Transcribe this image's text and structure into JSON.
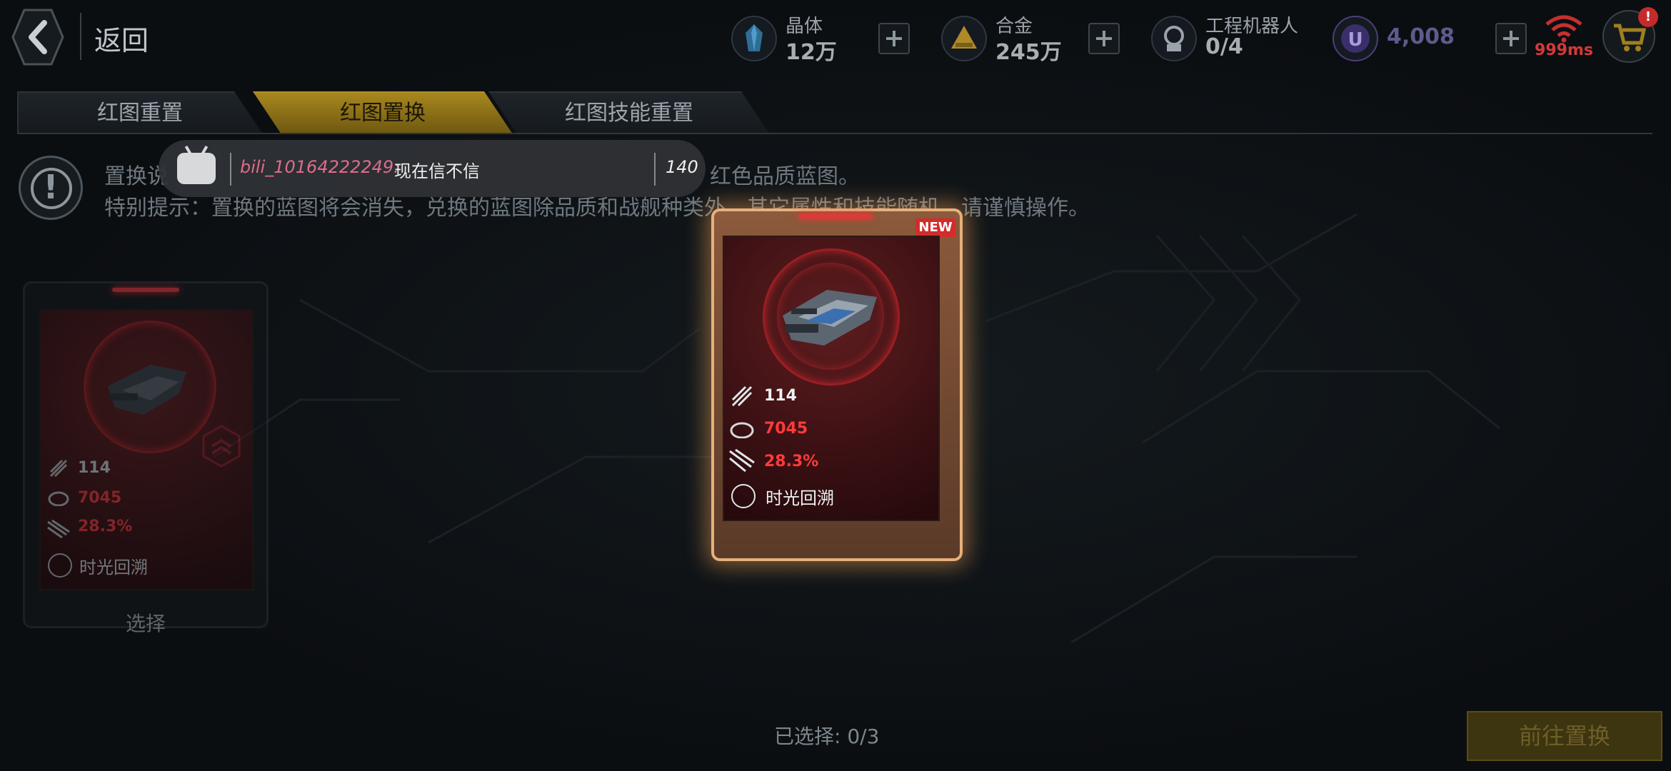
{
  "topbar": {
    "back_label": "返回",
    "resources": [
      {
        "name": "晶体",
        "value": "12万",
        "icon": "crystal-icon"
      },
      {
        "name": "合金",
        "value": "245万",
        "icon": "alloy-icon"
      },
      {
        "name": "工程机器人",
        "value": "0/4",
        "icon": "robot-icon"
      }
    ],
    "currency_value": "4,008",
    "ping": "999ms",
    "cart_badge": "!"
  },
  "tabs": [
    {
      "label": "红图重置",
      "active": false
    },
    {
      "label": "红图置换",
      "active": true
    },
    {
      "label": "红图技能重置",
      "active": false
    }
  ],
  "info": {
    "line1_left": "置换说",
    "line1_right": "红色品质蓝图。",
    "line2": "特别提示：置换的蓝图将会消失，兑换的蓝图除品质和战舰种类外，其它属性和技能随机，请谨慎操作。"
  },
  "danmaku": {
    "user": "bili_10164222249:",
    "message": "现在信不信",
    "count": "140"
  },
  "small_card": {
    "stat_fire": "114",
    "stat_hp": "7045",
    "stat_pct": "28.3%",
    "skill": "时光回溯",
    "select_label": "选择"
  },
  "featured_card": {
    "badge": "NEW",
    "stat_fire": "114",
    "stat_hp": "7045",
    "stat_pct": "28.3%",
    "skill": "时光回溯"
  },
  "footer": {
    "selected": "已选择: 0/3",
    "go_button": "前往置换"
  },
  "colors": {
    "accent_gold": "#a8871e",
    "red_stat": "#e2373a",
    "card_glow": "#e7b07a"
  }
}
